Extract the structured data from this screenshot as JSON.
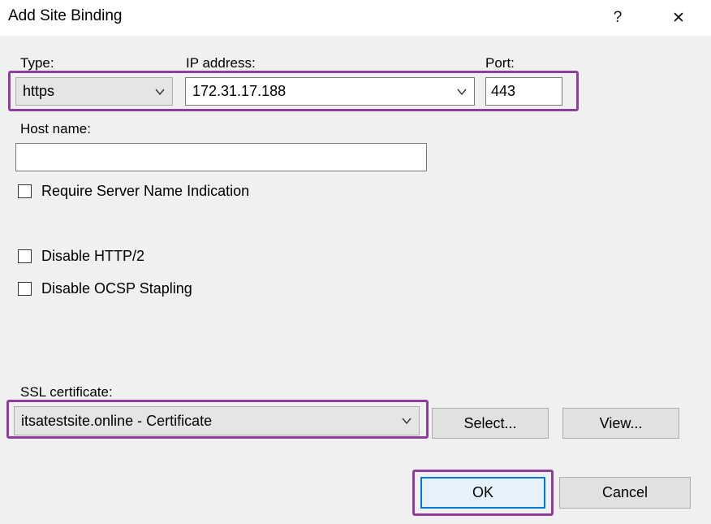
{
  "window": {
    "title": "Add Site Binding",
    "help_label": "?",
    "close_label": "✕"
  },
  "binding": {
    "type_label": "Type:",
    "type_value": "https",
    "ip_label": "IP address:",
    "ip_value": "172.31.17.188",
    "port_label": "Port:",
    "port_value": "443",
    "host_label": "Host name:",
    "host_value": ""
  },
  "options": {
    "sni_label": "Require Server Name Indication",
    "http2_label": "Disable HTTP/2",
    "ocsp_label": "Disable OCSP Stapling"
  },
  "ssl": {
    "label": "SSL certificate:",
    "value": "itsatestsite.online - Certificate",
    "select_label": "Select...",
    "view_label": "View..."
  },
  "actions": {
    "ok_label": "OK",
    "cancel_label": "Cancel"
  },
  "colors": {
    "highlight": "#8e3e9b",
    "focus": "#0078d7"
  }
}
